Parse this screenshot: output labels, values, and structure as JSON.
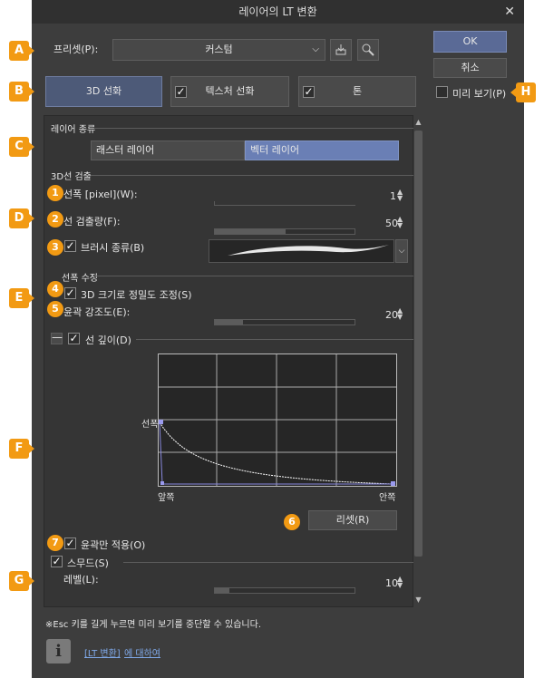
{
  "window": {
    "title": "레이어의 LT 변환"
  },
  "preset": {
    "label": "프리셋(P):",
    "value": "커스텀"
  },
  "buttons": {
    "ok": "OK",
    "cancel": "취소",
    "preview": "미리 보기(P)",
    "reset": "리셋(R)"
  },
  "mode_buttons": {
    "line": "3D 선화",
    "texture": "텍스처 선화",
    "tone": "톤"
  },
  "layer_type": {
    "heading": "레이어 종류",
    "raster": "래스터 레이어",
    "vector": "벡터 레이어",
    "selected": "vector"
  },
  "line_detect": {
    "heading": "3D선 검출",
    "width_label": "선폭 [pixel](W):",
    "width_value": "1",
    "amount_label": "선 검출량(F):",
    "amount_value": "50",
    "amount_fraction": 0.5,
    "brush_label": "브러시 종류(B)"
  },
  "line_fix": {
    "heading": "선폭 수정",
    "precision_label": "3D 크기로 정밀도 조정(S)",
    "emphasis_label": "윤곽 강조도(E):",
    "emphasis_value": "20",
    "emphasis_fraction": 0.2,
    "depth_label": "선 깊이(D)",
    "graph_y": "선폭",
    "graph_x_front": "앞쪽",
    "graph_x_back": "안쪽",
    "outline_only": "윤곽만 적용(O)"
  },
  "smooth": {
    "label": "스무드(S)",
    "level_label": "레벨(L):",
    "level_value": "10",
    "level_fraction": 0.1
  },
  "footer": {
    "note": "※Esc 키를 길게 누르면 미리 보기를 중단할 수 있습니다.",
    "link_text": "[LT 변환]",
    "link_suffix": "에 대하여"
  },
  "callouts": {
    "A": "A",
    "B": "B",
    "C": "C",
    "D": "D",
    "E": "E",
    "F": "F",
    "G": "G",
    "H": "H",
    "n1": "1",
    "n2": "2",
    "n3": "3",
    "n4": "4",
    "n5": "5",
    "n6": "6",
    "n7": "7"
  },
  "colors": {
    "badge": "#f29a13",
    "selected_tab": "#6a7fb5",
    "mode_selected": "#4d5a78"
  },
  "icons": {
    "dropdown": "chevron-down-icon",
    "save_preset": "save-preset-icon",
    "settings": "wrench-icon",
    "info": "info-icon",
    "close": "close-icon"
  }
}
